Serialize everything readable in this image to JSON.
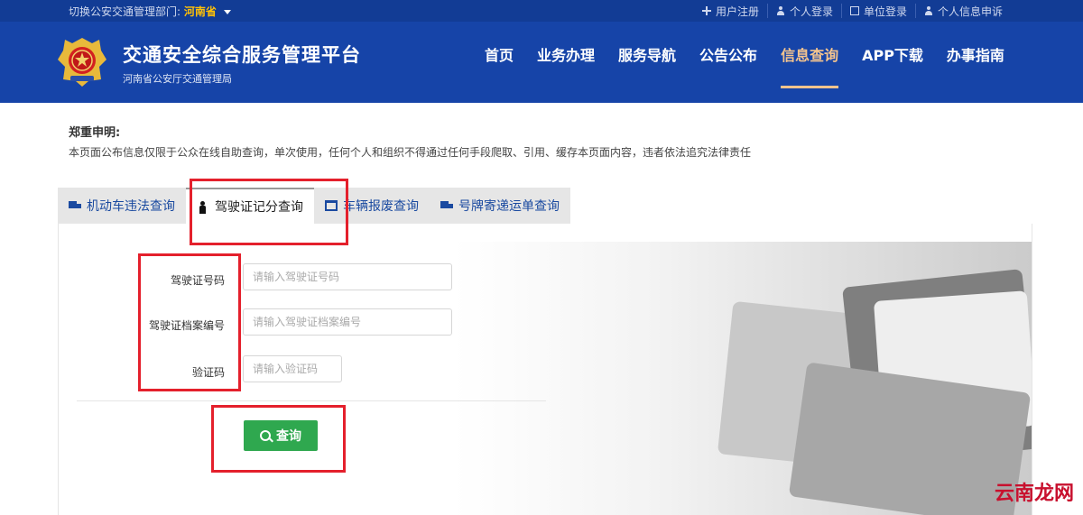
{
  "topbar": {
    "region_prefix": "切换公安交通管理部门:",
    "region_value": "河南省",
    "links": [
      "用户注册",
      "个人登录",
      "单位登录",
      "个人信息申诉"
    ]
  },
  "header": {
    "title": "交通安全综合服务管理平台",
    "subtitle": "河南省公安厅交通管理局"
  },
  "nav": {
    "items": [
      "首页",
      "业务办理",
      "服务导航",
      "公告公布",
      "信息查询",
      "APP下载",
      "办事指南"
    ],
    "active": "信息查询"
  },
  "notice": {
    "title": "郑重申明:",
    "text": "本页面公布信息仅限于公众在线自助查询，单次使用，任何个人和组织不得通过任何手段爬取、引用、缓存本页面内容，违者依法追究法律责任"
  },
  "tabs": [
    {
      "label": "机动车违法查询",
      "icon": "truck-icon"
    },
    {
      "label": "驾驶证记分查询",
      "icon": "person-icon",
      "active": true
    },
    {
      "label": "车辆报废查询",
      "icon": "bin-icon"
    },
    {
      "label": "号牌寄递运单查询",
      "icon": "truck-icon"
    }
  ],
  "form": {
    "license_label": "驾驶证号码",
    "license_placeholder": "请输入驾驶证号码",
    "file_label": "驾驶证档案编号",
    "file_placeholder": "请输入驾驶证档案编号",
    "captcha_label": "验证码",
    "captcha_placeholder": "请输入验证码",
    "submit_label": "查询"
  },
  "watermark": "云南龙网",
  "colors": {
    "header_bg": "#1644a8",
    "topbar_bg": "#123c95",
    "active_nav": "#f4c48e",
    "button_green": "#2fa84f",
    "highlight_red": "#e4202c"
  }
}
